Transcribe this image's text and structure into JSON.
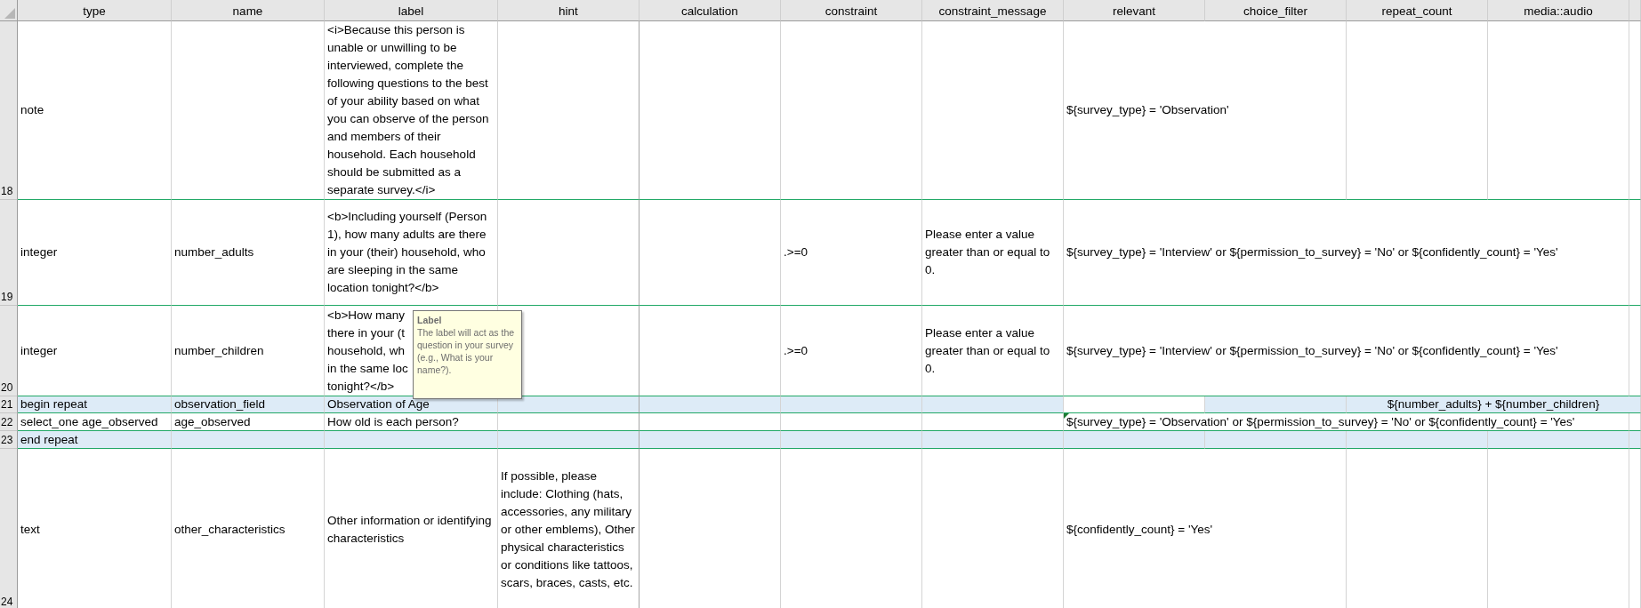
{
  "columns": [
    {
      "label": "type"
    },
    {
      "label": "name"
    },
    {
      "label": "label",
      "wrap": true
    },
    {
      "label": "hint",
      "wrap": true
    },
    {
      "label": "calculation"
    },
    {
      "label": "constraint"
    },
    {
      "label": "constraint_message",
      "wrap": true
    },
    {
      "label": "relevant",
      "wrap": false
    },
    {
      "label": "choice_filter"
    },
    {
      "label": "repeat_count",
      "wrap": false
    },
    {
      "label": "media::audio"
    }
  ],
  "rows": [
    {
      "number": "18",
      "highlighted": false,
      "cells": [
        "note",
        null,
        "<i>Because this person is unable or unwilling to be interviewed, complete the following questions to the best of your ability based on what you can observe of the person and members of their household. Each household should be submitted as a separate survey.</i>",
        null,
        null,
        null,
        null,
        "${survey_type} = 'Observation'",
        null,
        null,
        null
      ]
    },
    {
      "number": "19",
      "highlighted": false,
      "cells": [
        "integer",
        "number_adults",
        "<b>Including yourself (Person 1), how many adults are there in your (their) household, who are sleeping in the same location tonight?</b>",
        null,
        null,
        ".>=0",
        "Please enter a value greater than or equal to 0.",
        "${survey_type} = 'Interview' or ${permission_to_survey} = 'No' or ${confidently_count} = 'Yes'",
        null,
        null,
        null
      ]
    },
    {
      "number": "20",
      "highlighted": false,
      "cells": [
        "integer",
        "number_children",
        {
          "lines": [
            "<b>How many",
            "there in your (t",
            "household, wh",
            "in the same loc",
            "tonight?</b>"
          ]
        },
        null,
        null,
        ".>=0",
        "Please enter a value greater than or equal to 0.",
        "${survey_type} = 'Interview' or ${permission_to_survey} = 'No' or ${confidently_count} = 'Yes'",
        null,
        null,
        null
      ]
    },
    {
      "number": "21",
      "highlighted": true,
      "cells": [
        "begin repeat",
        "observation_field",
        "Observation of Age",
        null,
        null,
        null,
        null,
        {
          "highlighted": false
        },
        null,
        {
          "text": "${number_adults} + ${number_children}",
          "centered": true
        },
        null
      ]
    },
    {
      "number": "22",
      "highlighted": false,
      "cells": [
        "select_one age_observed",
        "age_observed",
        "How old is each person?",
        null,
        null,
        null,
        null,
        {
          "text": "${survey_type} = 'Observation' or ${permission_to_survey} = 'No' or ${confidently_count} = 'Yes'",
          "error_flag": true
        },
        null,
        null,
        null
      ]
    },
    {
      "number": "23",
      "highlighted": true,
      "cells": [
        "end repeat",
        null,
        null,
        null,
        null,
        null,
        null,
        null,
        null,
        null,
        null
      ]
    },
    {
      "number": "24",
      "highlighted": false,
      "cells": [
        "text",
        "other_characteristics",
        "Other information or identifying characteristics",
        "If possible, please include: Clothing (hats, accessories, any military or other emblems), Other physical characteristics or conditions like tattoos, scars, braces, casts, etc.",
        null,
        null,
        null,
        "${confidently_count} = 'Yes'",
        null,
        null,
        null
      ]
    }
  ],
  "tooltip": {
    "title": "Label",
    "text": "The label will act as the question in your survey (e.g., What is your name?)."
  }
}
